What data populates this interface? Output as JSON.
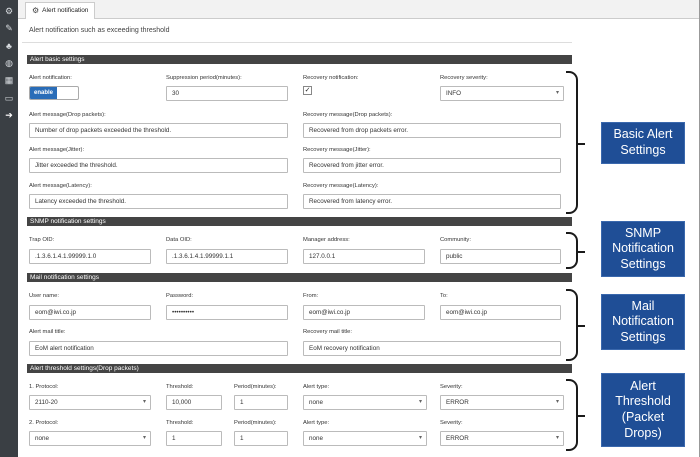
{
  "tab": {
    "title": "Alert notification"
  },
  "description": "Alert notification such as exceeding threshold",
  "basic": {
    "header": "Alert basic settings",
    "alert_notification_label": "Alert notification:",
    "toggle_label": "enable",
    "suppression_label": "Suppression period(minutes):",
    "suppression_value": "30",
    "recovery_notification_label": "Recovery notification:",
    "recovery_checked": "✓",
    "recovery_severity_label": "Recovery severity:",
    "recovery_severity_value": "INFO",
    "drop_msg_label": "Alert message(Drop packets):",
    "drop_msg_value": "Number of drop packets exceeded the threshold.",
    "drop_rec_label": "Recovery message(Drop packets):",
    "drop_rec_value": "Recovered from drop packets error.",
    "jitter_msg_label": "Alert message(Jitter):",
    "jitter_msg_value": "Jitter exceeded the threshold.",
    "jitter_rec_label": "Recovery message(Jitter):",
    "jitter_rec_value": "Recovered from jitter error.",
    "latency_msg_label": "Alert message(Latency):",
    "latency_msg_value": "Latency exceeded the threshold.",
    "latency_rec_label": "Recovery message(Latency):",
    "latency_rec_value": "Recovered from latency error."
  },
  "snmp": {
    "header": "SNMP notification settings",
    "trap_label": "Trap OID:",
    "trap_value": ".1.3.6.1.4.1.99999.1.0",
    "data_label": "Data OID:",
    "data_value": ".1.3.6.1.4.1.99999.1.1",
    "manager_label": "Manager address:",
    "manager_value": "127.0.0.1",
    "community_label": "Community:",
    "community_value": "public"
  },
  "mail": {
    "header": "Mail notification settings",
    "user_label": "User name:",
    "user_value": "eom@iwi.co.jp",
    "password_label": "Password:",
    "password_value": "••••••••••",
    "from_label": "From:",
    "from_value": "eom@iwi.co.jp",
    "to_label": "To:",
    "to_value": "eom@iwi.co.jp",
    "alert_title_label": "Alert mail title:",
    "alert_title_value": "EoM alert notification",
    "recovery_title_label": "Recovery mail title:",
    "recovery_title_value": "EoM recovery notification"
  },
  "threshold": {
    "header": "Alert threshold settings(Drop packets)",
    "rows": [
      {
        "protocol_label": "1. Protocol:",
        "protocol": "2110-20",
        "threshold_label": "Threshold:",
        "threshold": "10,000",
        "period_label": "Period(minutes):",
        "period": "1",
        "alert_type_label": "Alert type:",
        "alert_type": "none",
        "severity_label": "Severity:",
        "severity": "ERROR"
      },
      {
        "protocol_label": "2. Protocol:",
        "protocol": "none",
        "threshold_label": "Threshold:",
        "threshold": "1",
        "period_label": "Period(minutes):",
        "period": "1",
        "alert_type_label": "Alert type:",
        "alert_type": "none",
        "severity_label": "Severity:",
        "severity": "ERROR"
      }
    ]
  },
  "callouts": {
    "basic": [
      "Basic Alert",
      "Settings"
    ],
    "snmp": [
      "SNMP",
      "Notification",
      "Settings"
    ],
    "mail": [
      "Mail",
      "Notification",
      "Settings"
    ],
    "threshold": [
      "Alert",
      "Threshold",
      "(Packet",
      "Drops)"
    ]
  },
  "colors": {
    "sidebar": "#3a3f44",
    "section_header": "#444444",
    "toggle_on": "#2a6db8",
    "callout": "#1f4e96"
  }
}
